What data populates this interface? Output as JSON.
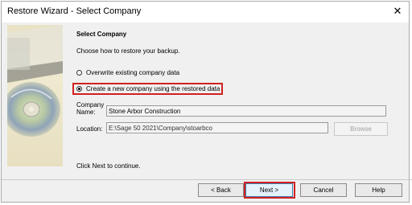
{
  "window": {
    "title": "Restore Wizard - Select Company",
    "close_glyph": "✕"
  },
  "page": {
    "heading": "Select Company",
    "prompt": "Choose how to restore your backup.",
    "continue_hint": "Click Next to continue."
  },
  "options": {
    "overwrite": {
      "label": "Overwrite existing company data",
      "selected": false
    },
    "create_new": {
      "label": "Create a new company using the restored data",
      "selected": true
    }
  },
  "fields": {
    "company_name_label_line1": "Company",
    "company_name_label_line2": "Name:",
    "company_name_value": "Stone Arbor Construction",
    "location_label": "Location:",
    "location_value": "E:\\Sage 50 2021\\Company\\stoarbco"
  },
  "buttons": {
    "browse": "Browse",
    "back": "< Back",
    "next": "Next >",
    "cancel": "Cancel",
    "help": "Help"
  },
  "colors": {
    "highlight_outline": "#d12121",
    "disabled_text": "#a0a0a0"
  }
}
